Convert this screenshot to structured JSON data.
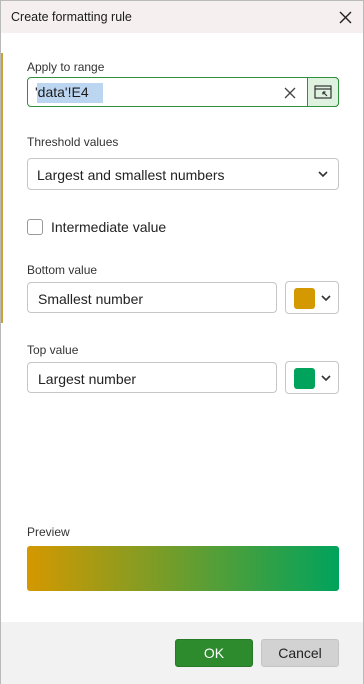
{
  "dialog": {
    "title": "Create formatting rule",
    "close_icon": "close-icon"
  },
  "apply_range": {
    "label": "Apply to range",
    "value": "'data'!E4",
    "clear_icon": "clear-x-icon",
    "pick_icon": "range-select-icon"
  },
  "threshold": {
    "label": "Threshold values",
    "selected": "Largest and smallest numbers",
    "chevron_icon": "chevron-down-icon"
  },
  "intermediate": {
    "label": "Intermediate value",
    "checked": false
  },
  "bottom": {
    "label": "Bottom value",
    "value": "Smallest number",
    "color": "#d49800"
  },
  "top": {
    "label": "Top value",
    "value": "Largest number",
    "color": "#00a35c"
  },
  "preview": {
    "label": "Preview",
    "gradient_from": "#d49800",
    "gradient_to": "#00a35c"
  },
  "buttons": {
    "ok": "OK",
    "cancel": "Cancel"
  },
  "colors": {
    "accent": "#2d8a2d",
    "titlebar": "#f5eff0",
    "footer": "#f2f2f2"
  }
}
